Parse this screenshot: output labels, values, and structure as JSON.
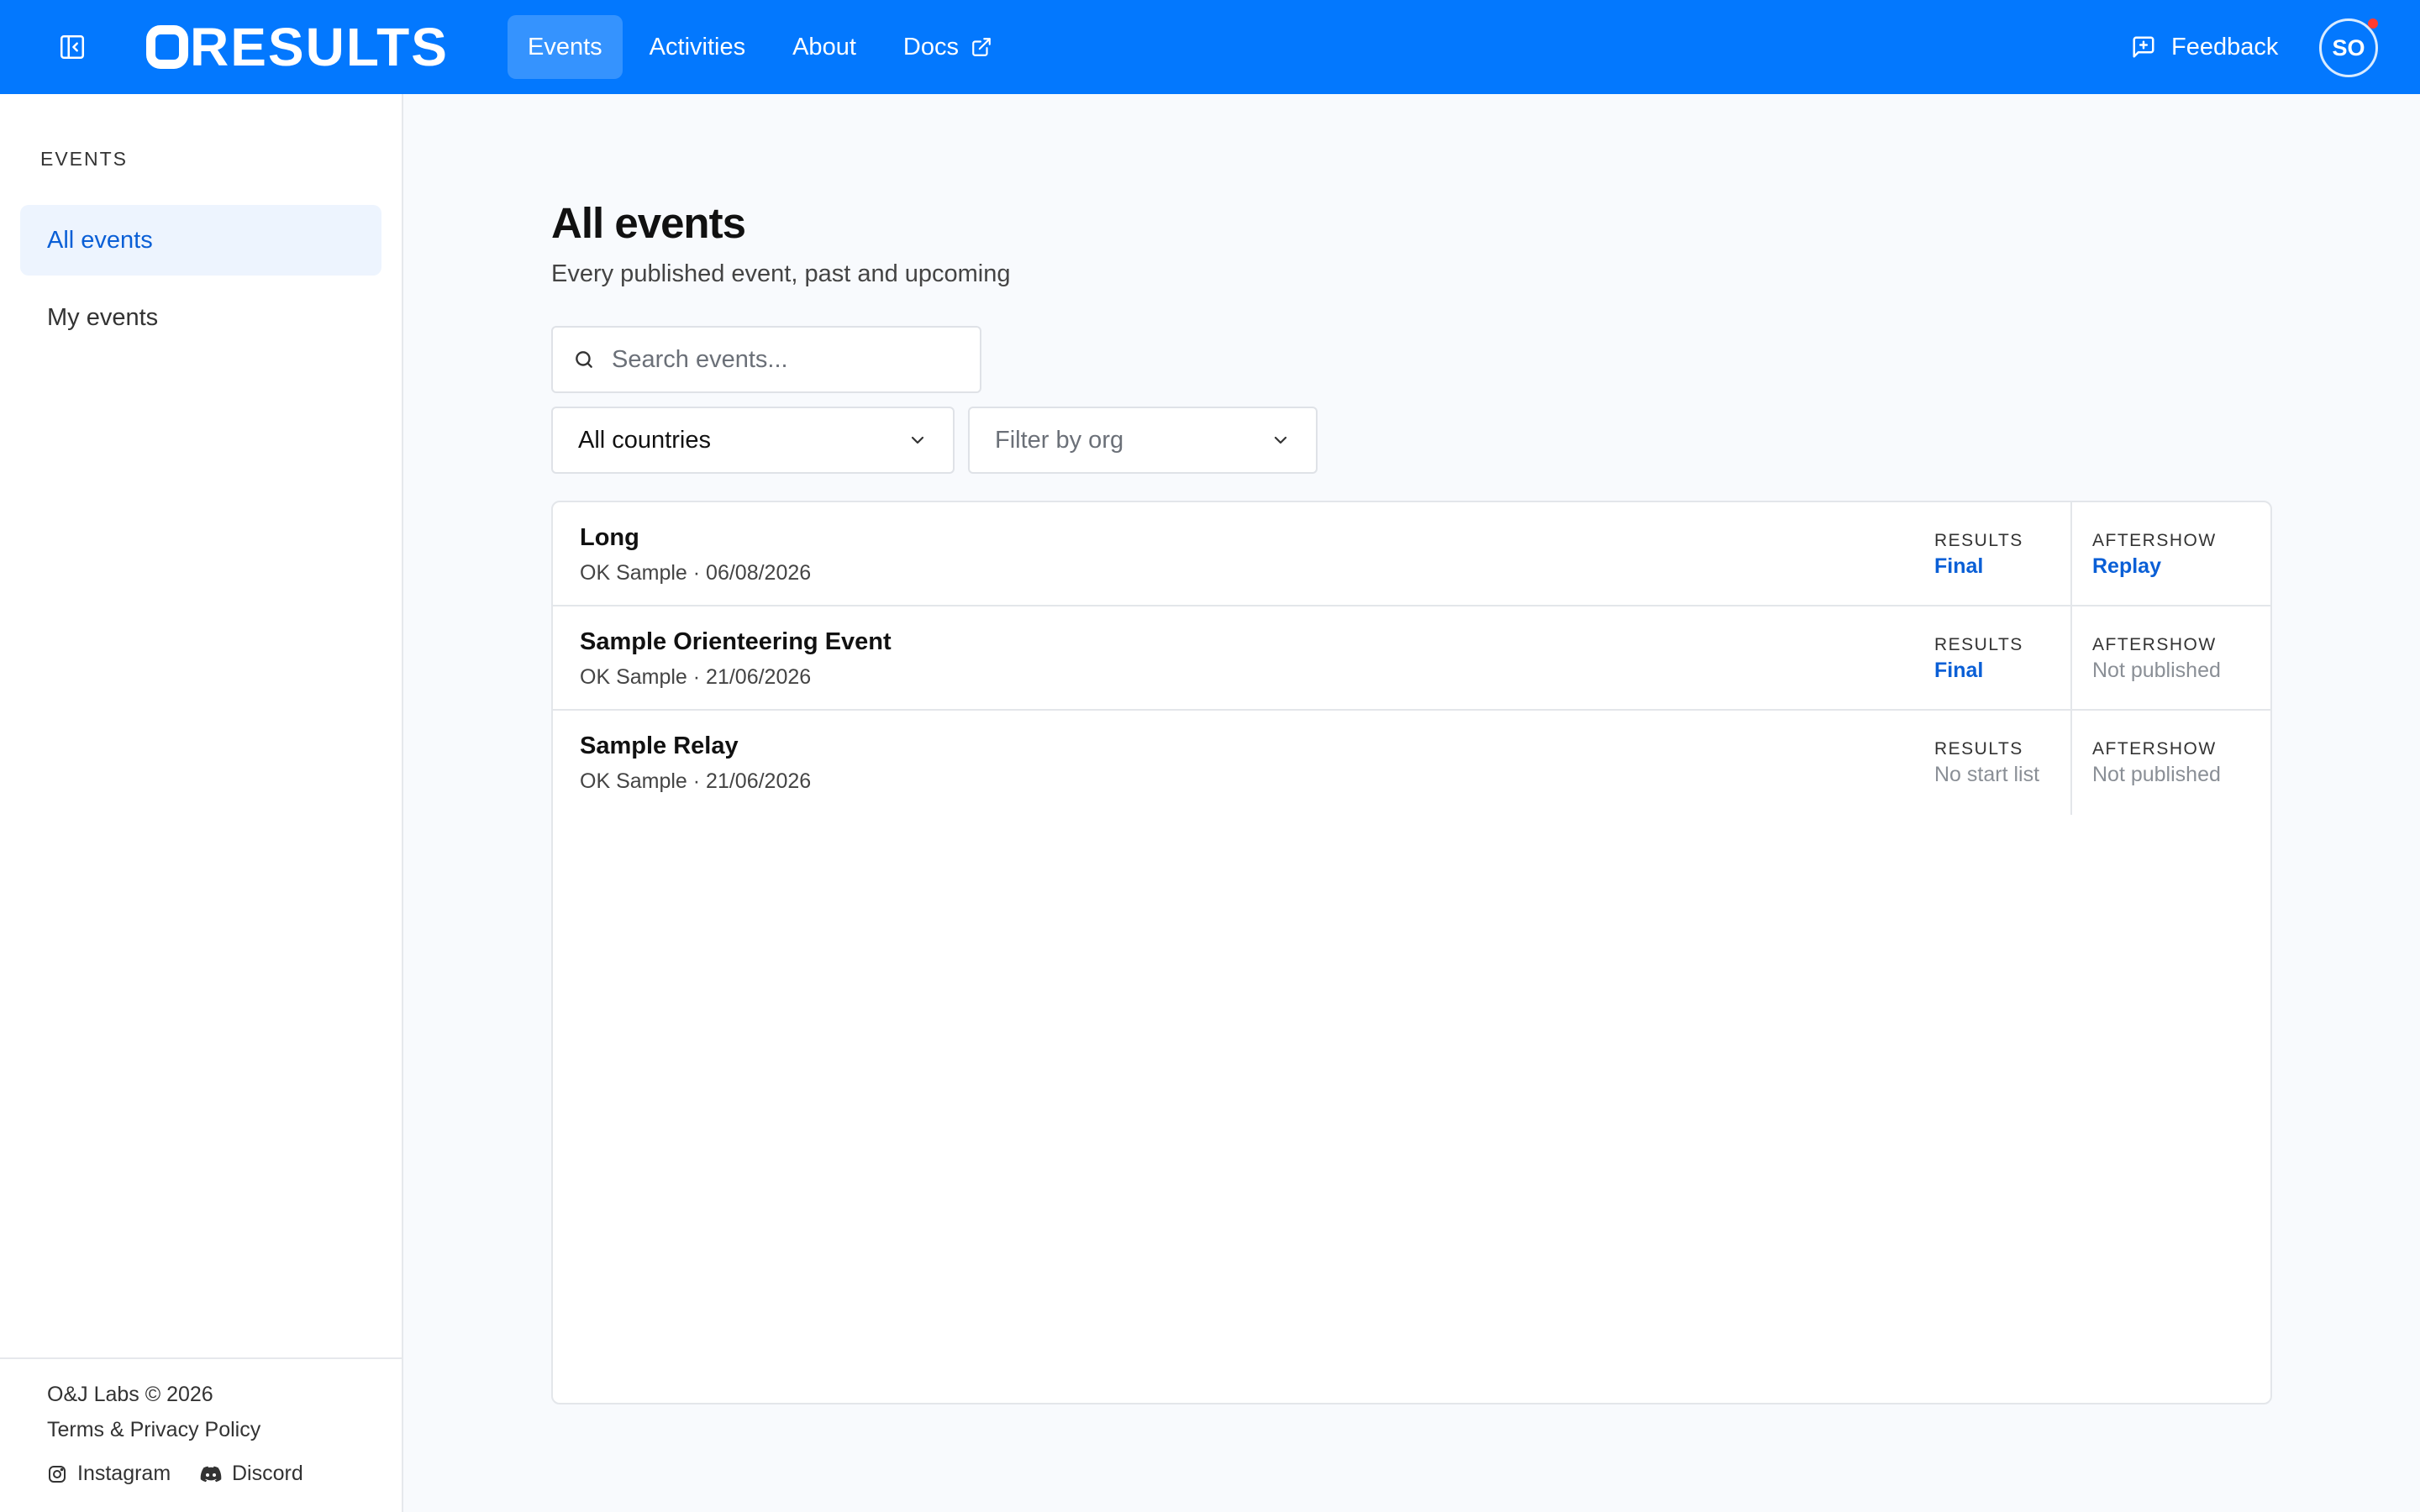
{
  "header": {
    "logo_text": "RESULTS",
    "nav": [
      {
        "label": "Events",
        "active": true
      },
      {
        "label": "Activities",
        "active": false
      },
      {
        "label": "About",
        "active": false
      },
      {
        "label": "Docs",
        "external": true
      }
    ],
    "feedback_label": "Feedback",
    "avatar_initials": "SO",
    "brand_color": "#0378fe"
  },
  "sidebar": {
    "heading": "EVENTS",
    "items": [
      {
        "label": "All events",
        "active": true
      },
      {
        "label": "My events",
        "active": false
      }
    ],
    "footer": {
      "copyright": "O&J Labs © 2026",
      "terms": "Terms & Privacy Policy",
      "instagram": "Instagram",
      "discord": "Discord"
    }
  },
  "main": {
    "title": "All events",
    "subtitle": "Every published event, past and upcoming",
    "search_placeholder": "Search events...",
    "country_select": "All countries",
    "org_select_placeholder": "Filter by org",
    "events": [
      {
        "name": "Long",
        "meta": "OK Sample · 06/08/2026",
        "results_label": "RESULTS",
        "results_value": "Final",
        "aftershow_label": "AFTERSHOW",
        "aftershow_value": "Replay"
      },
      {
        "name": "Sample Orienteering Event",
        "meta": "OK Sample · 21/06/2026",
        "results_label": "RESULTS",
        "results_value": "Final",
        "aftershow_label": "AFTERSHOW",
        "aftershow_value": "Not published"
      },
      {
        "name": "Sample Relay",
        "meta": "OK Sample · 21/06/2026",
        "results_label": "RESULTS",
        "results_value": "No start list",
        "aftershow_label": "AFTERSHOW",
        "aftershow_value": "Not published"
      }
    ]
  }
}
